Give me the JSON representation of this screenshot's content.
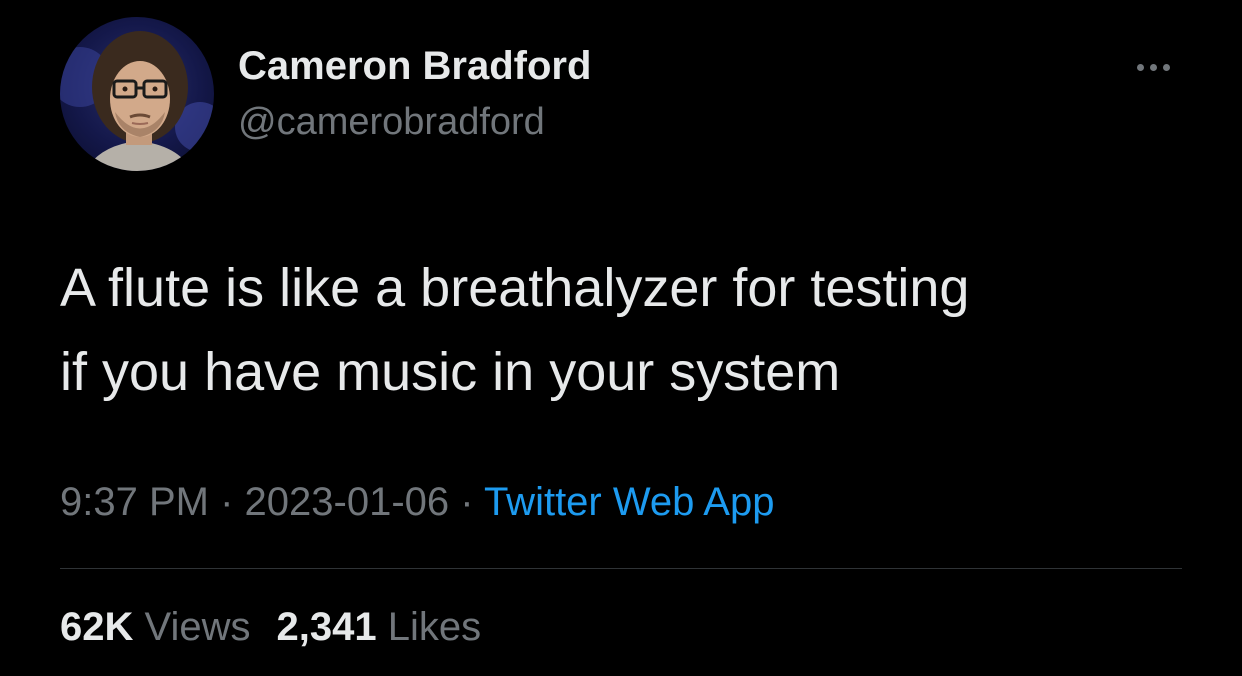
{
  "author": {
    "display_name": "Cameron Bradford",
    "handle": "@camerobradford",
    "avatar": "avatar-photo"
  },
  "more_icon": "more-dots-icon",
  "tweet": {
    "line1": "A flute is like a breathalyzer for testing",
    "line2": "if you have music in your system"
  },
  "meta": {
    "time": "9:37 PM",
    "sep1": " · ",
    "date": "2023-01-06",
    "sep2": " · ",
    "source": "Twitter Web App"
  },
  "stats": {
    "views_count": "62K",
    "views_label": "Views",
    "likes_count": "2,341",
    "likes_label": "Likes"
  },
  "colors": {
    "background": "#000000",
    "primary_text": "#e7e9ea",
    "secondary_text": "#71767b",
    "link": "#1d9bf0",
    "divider": "#2f3336"
  }
}
